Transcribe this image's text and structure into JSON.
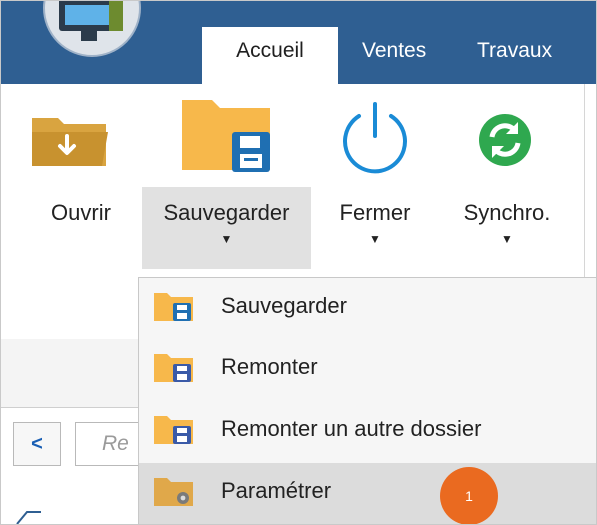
{
  "tabs": [
    {
      "label": "Accueil",
      "active": true
    },
    {
      "label": "Ventes",
      "active": false
    },
    {
      "label": "Travaux",
      "active": false
    }
  ],
  "ribbon": {
    "buttons": [
      {
        "label": "Ouvrir",
        "icon": "folder-open-icon"
      },
      {
        "label": "Sauvegarder",
        "icon": "folder-save-icon",
        "has_dropdown": true,
        "pressed": true
      },
      {
        "label": "Fermer",
        "icon": "power-icon",
        "has_dropdown": true
      },
      {
        "label": "Synchro.",
        "icon": "sync-icon",
        "has_dropdown": true
      }
    ],
    "dropdown_arrow": "▼"
  },
  "search": {
    "back_label": "<",
    "placeholder": "Re"
  },
  "menu": {
    "items": [
      {
        "label": "Sauvegarder",
        "icon": "folder-save-icon"
      },
      {
        "label": "Remonter",
        "icon": "folder-restore-icon"
      },
      {
        "label": "Remonter un autre dossier",
        "icon": "folder-restore-icon"
      },
      {
        "label": "Paramétrer",
        "icon": "folder-settings-icon",
        "highlighted": true
      }
    ]
  },
  "badge": {
    "text": "1"
  },
  "colors": {
    "tab_bar": "#2f5f92",
    "folder": "#f7b84b",
    "save_blue": "#1f6fb2",
    "power_blue": "#1a8bd6",
    "sync_green": "#2fa84f",
    "badge_orange": "#ea6a20"
  }
}
